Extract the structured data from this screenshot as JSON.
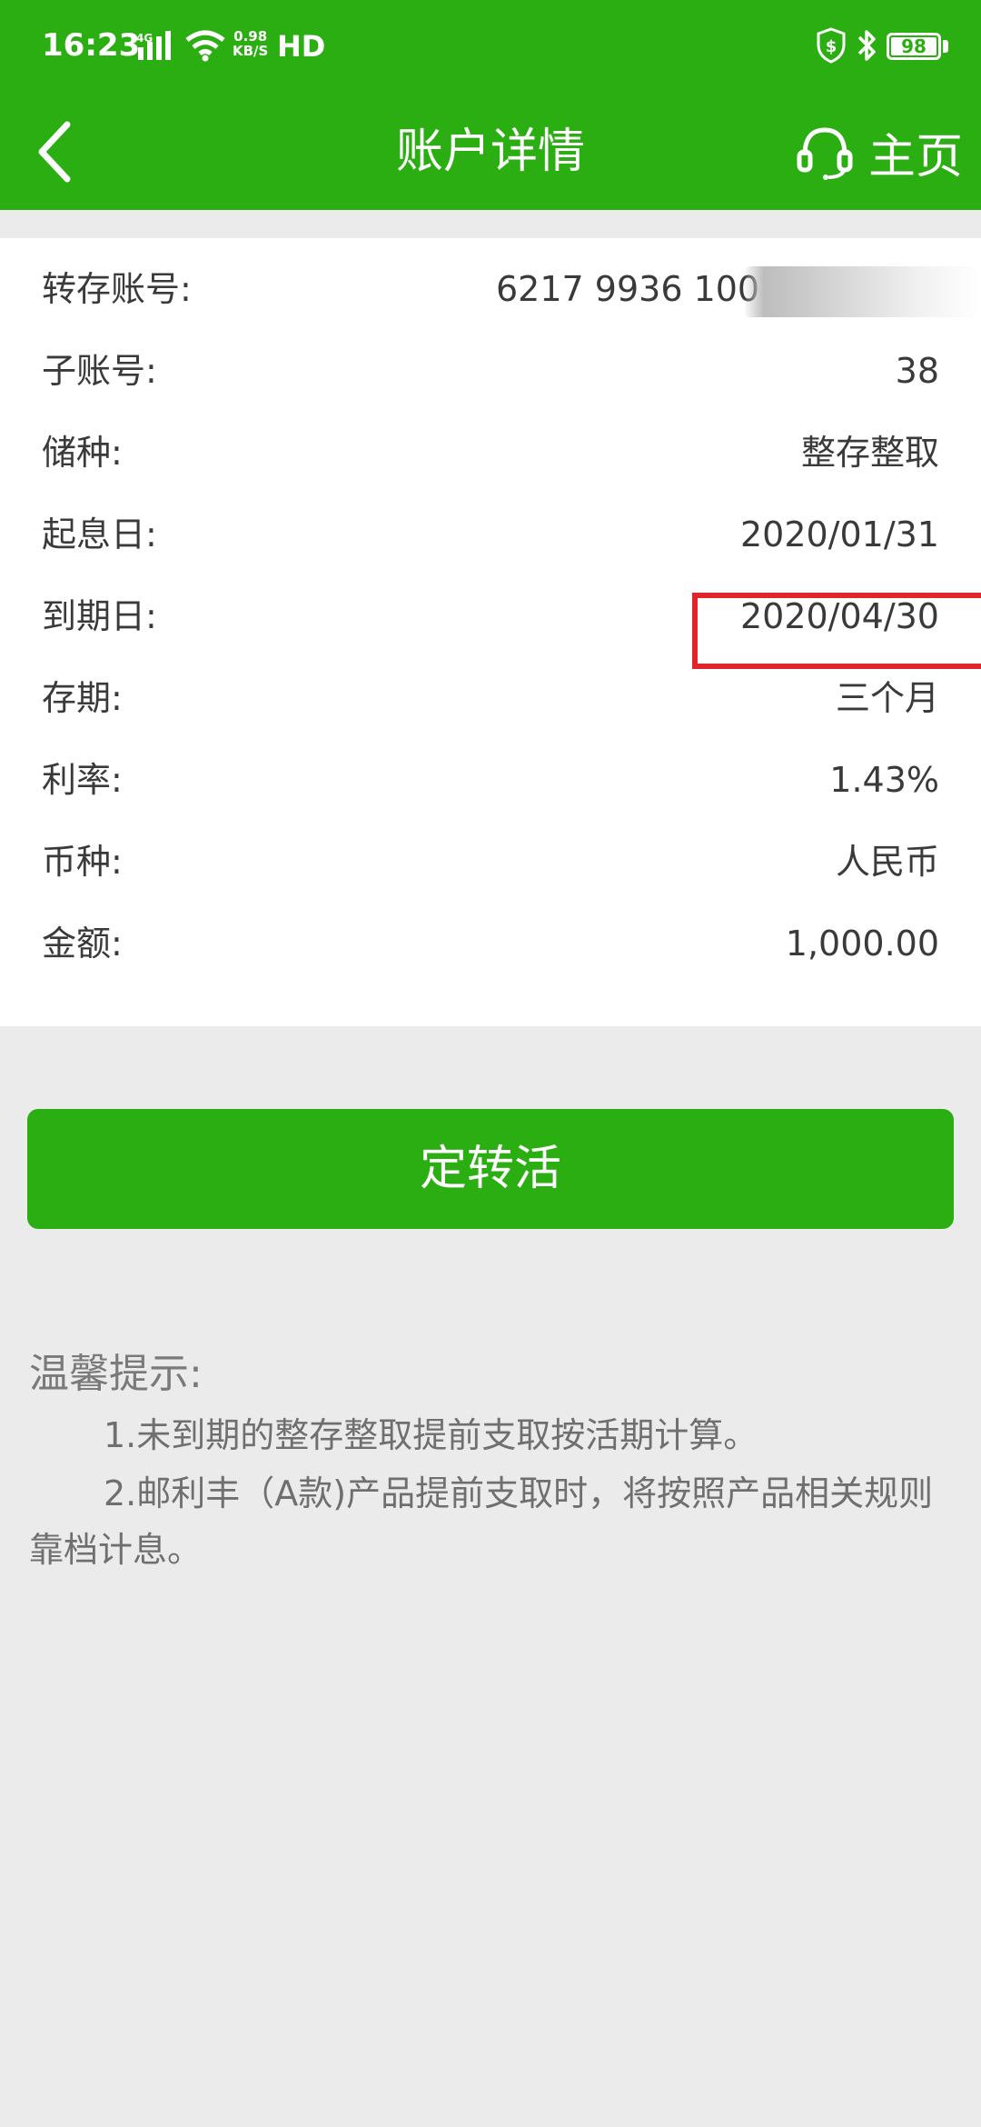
{
  "status_bar": {
    "time": "16:23",
    "net_speed_value": "0.98",
    "net_speed_unit": "KB/S",
    "hd": "HD",
    "battery": "98",
    "icons": [
      "signal-4g-icon",
      "wifi-icon",
      "shield-dollar-icon",
      "bluetooth-icon",
      "battery-icon"
    ]
  },
  "nav": {
    "title": "账户详情",
    "home_label": "主页"
  },
  "details": [
    {
      "label": "转存账号:",
      "value": "6217 9936 100"
    },
    {
      "label": "子账号:",
      "value": "38"
    },
    {
      "label": "储种:",
      "value": "整存整取"
    },
    {
      "label": "起息日:",
      "value": "2020/01/31"
    },
    {
      "label": "到期日:",
      "value": "2020/04/30"
    },
    {
      "label": "存期:",
      "value": "三个月"
    },
    {
      "label": "利率:",
      "value": "1.43%"
    },
    {
      "label": "币种:",
      "value": "人民币"
    },
    {
      "label": "金额:",
      "value": "1,000.00"
    }
  ],
  "action_button": "定转活",
  "tips": {
    "title": "温馨提示:",
    "items": [
      "1.未到期的整存整取提前支取按活期计算。",
      "2.邮利丰（A款)产品提前支取时，将按照产品相关规则靠档计息。"
    ]
  },
  "colors": {
    "primary_green": "#2bae12",
    "highlight_red": "#e0262b",
    "page_background": "#ebebeb"
  }
}
